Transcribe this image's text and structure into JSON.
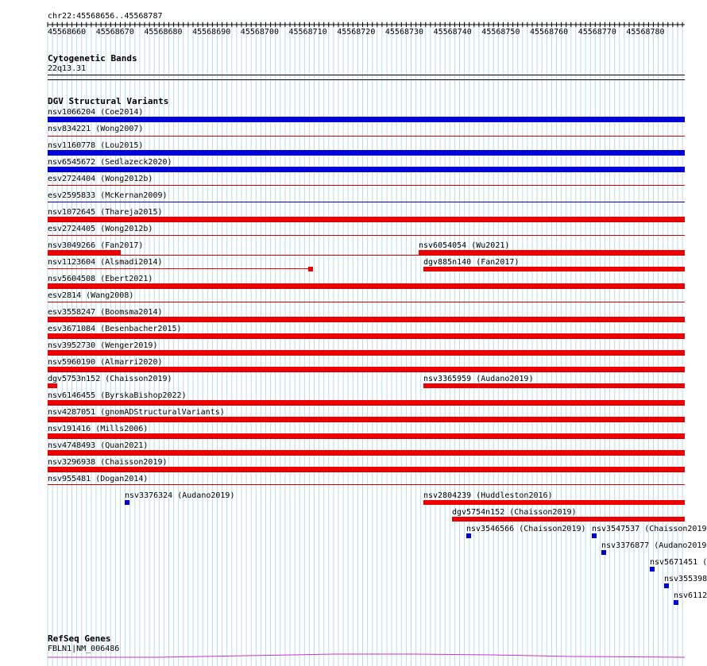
{
  "ruler": {
    "location": "chr22:45568656..45568787",
    "tick_labels": [
      "45568660",
      "45568670",
      "45568680",
      "45568690",
      "45568700",
      "45568710",
      "45568720",
      "45568730",
      "45568740",
      "45568750",
      "45568760",
      "45568770",
      "45568780"
    ]
  },
  "cytoband": {
    "title": "Cytogenetic Bands",
    "band": "22q13.31"
  },
  "dgv": {
    "title": "DGV Structural Variants",
    "colors": {
      "loss": "#ee0000",
      "gain": "#0000dd",
      "separator_red": "#cc0000",
      "separator_blue": "#0000cc"
    },
    "rows": [
      {
        "label": "nsv1066204 (Coe2014)",
        "type": "gain",
        "sep": "blue"
      },
      {
        "label": "nsv834221 (Wong2007)",
        "type": "loss",
        "sep": "red"
      },
      {
        "label": "nsv1160778 (Lou2015)",
        "type": "gain",
        "sep": "blue"
      },
      {
        "label": "nsv6545672 (Sedlazeck2020)",
        "type": "gain",
        "sep": "blue"
      },
      {
        "label": "esv2724404 (Wong2012b)",
        "type": "loss",
        "sep": "red"
      },
      {
        "label": "esv2595833 (McKernan2009)",
        "type": "gain",
        "sep": "blue"
      },
      {
        "label": "nsv1072645 (Thareja2015)",
        "type": "loss",
        "sep": "red"
      },
      {
        "label": "esv2724405 (Wong2012b)",
        "type": "loss",
        "sep": "red"
      },
      {
        "label": "nsv3049266 (Fan2017)",
        "type": "loss",
        "sep": "red"
      },
      {
        "label": "nsv6054054 (Wu2021)",
        "type": "loss",
        "sep": "none"
      },
      {
        "label": "nsv1123604 (Alsmadi2014)",
        "type": "loss",
        "sep": "none"
      },
      {
        "label": "dgv885n140 (Fan2017)",
        "type": "loss",
        "sep": "none"
      },
      {
        "label": "nsv5604508 (Ebert2021)",
        "type": "loss",
        "sep": "red"
      },
      {
        "label": "esv2814 (Wang2008)",
        "type": "loss",
        "sep": "red"
      },
      {
        "label": "esv3558247 (Boomsma2014)",
        "type": "loss",
        "sep": "red"
      },
      {
        "label": "esv3671084 (Besenbacher2015)",
        "type": "loss",
        "sep": "red"
      },
      {
        "label": "nsv3952730 (Wenger2019)",
        "type": "loss",
        "sep": "red"
      },
      {
        "label": "nsv5960190 (Almarri2020)",
        "type": "loss",
        "sep": "red"
      },
      {
        "label": "dgv5753n152 (Chaisson2019)",
        "type": "loss",
        "sep": "none"
      },
      {
        "label": "nsv3365959 (Audano2019)",
        "type": "loss",
        "sep": "none"
      },
      {
        "label": "nsv6146455 (ByrskaBishop2022)",
        "type": "loss",
        "sep": "red"
      },
      {
        "label": "nsv4287051 (gnomADStructuralVariants)",
        "type": "loss",
        "sep": "red"
      },
      {
        "label": "nsv191416 (Mills2006)",
        "type": "loss",
        "sep": "red"
      },
      {
        "label": "nsv4748493 (Quan2021)",
        "type": "loss",
        "sep": "red"
      },
      {
        "label": "nsv3296938 (Chaisson2019)",
        "type": "loss",
        "sep": "red"
      },
      {
        "label": "nsv955481 (Dogan2014)",
        "type": "loss",
        "sep": "red"
      },
      {
        "label": "nsv3376324 (Audano2019)",
        "type": "gain",
        "sep": "none"
      },
      {
        "label": "nsv2804239 (Huddleston2016)",
        "type": "loss",
        "sep": "none"
      },
      {
        "label": "dgv5754n152 (Chaisson2019)",
        "type": "loss",
        "sep": "none"
      },
      {
        "label": "nsv3546566 (Chaisson2019)",
        "type": "gain",
        "sep": "none"
      },
      {
        "label": "nsv3547537 (Chaisson2019",
        "type": "gain",
        "sep": "none"
      },
      {
        "label": "nsv3376877 (Audano2019",
        "type": "gain",
        "sep": "none"
      },
      {
        "label": "nsv5671451 (",
        "type": "gain",
        "sep": "none"
      },
      {
        "label": "nsv355398",
        "type": "gain",
        "sep": "none"
      },
      {
        "label": "nsv6112",
        "type": "gain",
        "sep": "none"
      }
    ]
  },
  "refseq": {
    "title": "RefSeq Genes",
    "gene": "FBLN1|NM_006486",
    "color": "#cc33cc"
  }
}
